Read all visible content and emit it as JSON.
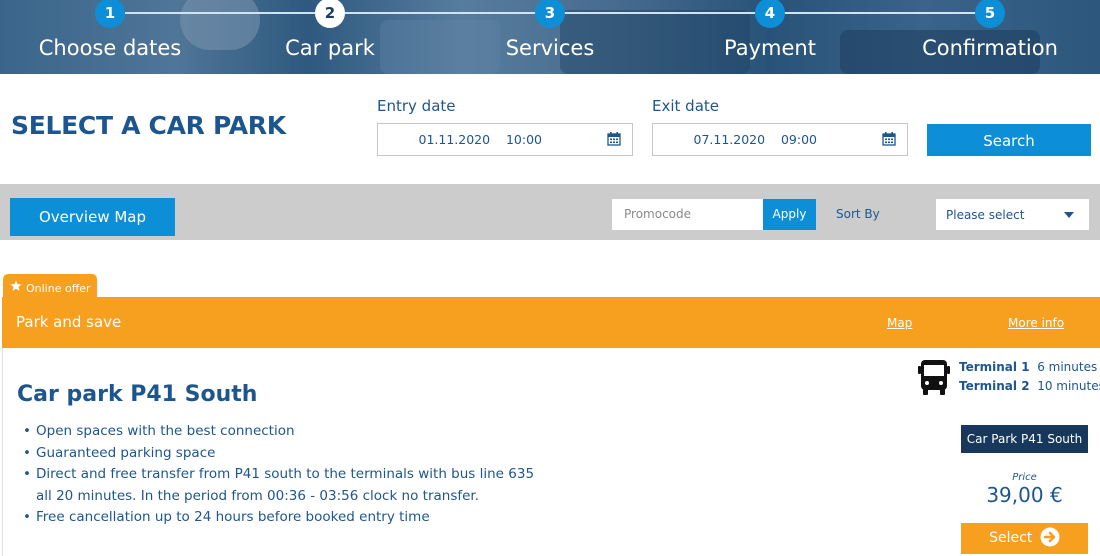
{
  "steps": [
    {
      "num": "1",
      "label": "Choose dates"
    },
    {
      "num": "2",
      "label": "Car park",
      "active": true
    },
    {
      "num": "3",
      "label": "Services"
    },
    {
      "num": "4",
      "label": "Payment"
    },
    {
      "num": "5",
      "label": "Confirmation"
    }
  ],
  "search": {
    "title": "SELECT A CAR PARK",
    "entry_label": "Entry date",
    "entry_value": "01.11.2020    10:00",
    "exit_label": "Exit date",
    "exit_value": "07.11.2020    09:00",
    "button": "Search"
  },
  "filters": {
    "overview_map": "Overview Map",
    "promo_placeholder": "Promocode",
    "apply": "Apply",
    "sort_label": "Sort By",
    "sort_value": "Please select"
  },
  "offer": {
    "tab_label": "Online offer",
    "title": "Park and save",
    "map_link": "Map",
    "more_info_link": "More info",
    "park_name": "Car park P41 South",
    "features": [
      "Open spaces with the best connection",
      "Guaranteed parking space",
      "Direct and free transfer from P41 south to the terminals with bus line 635 all 20 minutes. In the period from 00:36 - 03:56 clock no transfer.",
      "Free cancellation up to 24 hours before booked entry time"
    ],
    "terminals": [
      {
        "name": "Terminal 1",
        "time": "6 minutes"
      },
      {
        "name": "Terminal 2",
        "time": "10 minutes"
      }
    ],
    "badge": "Car Park P41 South",
    "price_label": "Price",
    "price": "39,00 €",
    "select": "Select"
  },
  "colors": {
    "primary_blue": "#0d8fd8",
    "text_blue": "#1d568f",
    "orange": "#f7a020",
    "navy": "#17385b",
    "filter_bg": "#cccccc"
  }
}
